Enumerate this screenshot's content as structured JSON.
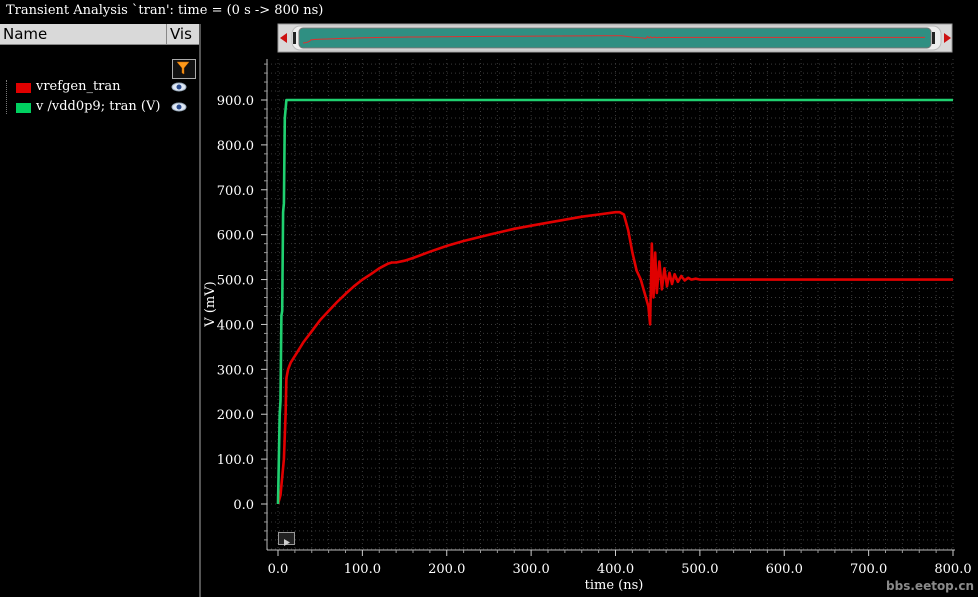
{
  "window": {
    "title": "Transient Analysis `tran': time = (0 s -> 800 ns)"
  },
  "legend": {
    "header_name": "Name",
    "header_vis": "Vis",
    "items": [
      {
        "label": "vrefgen_tran",
        "color": "#e00000"
      },
      {
        "label": "v /vdd0p9; tran (V)",
        "color": "#00d060"
      }
    ]
  },
  "watermark": "bbs.eetop.cn",
  "chart_data": {
    "type": "line",
    "xlabel": "time (ns)",
    "ylabel": "V (mV)",
    "xlim": [
      0,
      800
    ],
    "ylim": [
      -100,
      990
    ],
    "x_ticks": [
      0,
      100,
      200,
      300,
      400,
      500,
      600,
      700,
      800
    ],
    "x_tick_labels": [
      "0.0",
      "100.0",
      "200.0",
      "300.0",
      "400.0",
      "500.0",
      "600.0",
      "700.0",
      "800.0"
    ],
    "y_ticks": [
      0,
      100,
      200,
      300,
      400,
      500,
      600,
      700,
      800,
      900
    ],
    "y_tick_labels": [
      "0.0",
      "100.0",
      "200.0",
      "300.0",
      "400.0",
      "500.0",
      "600.0",
      "700.0",
      "800.0",
      "900.0"
    ],
    "grid": true,
    "background": "#000000",
    "series": [
      {
        "name": "vrefgen_tran",
        "color": "#e00000",
        "x": [
          0,
          3,
          5,
          7,
          9,
          10,
          12,
          15,
          20,
          30,
          40,
          50,
          60,
          70,
          80,
          90,
          100,
          110,
          120,
          130,
          135,
          140,
          150,
          160,
          180,
          200,
          220,
          250,
          280,
          300,
          330,
          360,
          380,
          400,
          405,
          410,
          415,
          420,
          425,
          430,
          433,
          436,
          439,
          441,
          443,
          445,
          447,
          449,
          452,
          455,
          458,
          461,
          464,
          467,
          470,
          474,
          478,
          482,
          486,
          490,
          495,
          500,
          550,
          600,
          650,
          700,
          750,
          800
        ],
        "y": [
          0,
          20,
          60,
          100,
          200,
          280,
          300,
          315,
          330,
          360,
          385,
          410,
          430,
          450,
          468,
          485,
          500,
          512,
          525,
          535,
          538,
          538,
          542,
          548,
          562,
          575,
          586,
          600,
          613,
          620,
          630,
          640,
          645,
          650,
          650,
          645,
          610,
          560,
          520,
          500,
          480,
          460,
          440,
          400,
          580,
          460,
          560,
          470,
          540,
          478,
          525,
          485,
          515,
          490,
          512,
          495,
          508,
          498,
          504,
          500,
          502,
          500,
          500,
          500,
          500,
          500,
          500,
          500
        ]
      },
      {
        "name": "v /vdd0p9; tran (V)",
        "color": "#20d070",
        "x": [
          0,
          2,
          3,
          4,
          5,
          6,
          7,
          8,
          10,
          800
        ],
        "y": [
          0,
          200,
          230,
          420,
          430,
          650,
          670,
          860,
          900,
          900
        ]
      }
    ]
  }
}
